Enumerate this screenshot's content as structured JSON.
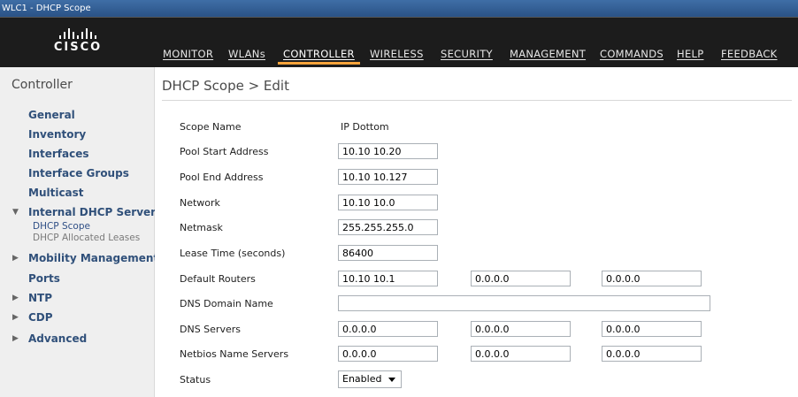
{
  "window": {
    "title": "WLC1 - DHCP Scope"
  },
  "brand": {
    "logo_text": "CISCO"
  },
  "nav": {
    "items": [
      {
        "label": "MONITOR"
      },
      {
        "label": "WLANs"
      },
      {
        "label": "CONTROLLER",
        "active": true
      },
      {
        "label": "WIRELESS"
      },
      {
        "label": "SECURITY"
      },
      {
        "label": "MANAGEMENT"
      },
      {
        "label": "COMMANDS"
      },
      {
        "label": "HELP"
      },
      {
        "label": "FEEDBACK"
      }
    ]
  },
  "sidebar": {
    "title": "Controller",
    "items": [
      {
        "label": "General"
      },
      {
        "label": "Inventory"
      },
      {
        "label": "Interfaces"
      },
      {
        "label": "Interface Groups"
      },
      {
        "label": "Multicast"
      },
      {
        "label": "Internal DHCP Server",
        "expanded": true
      },
      {
        "label": "Mobility Management"
      },
      {
        "label": "Ports"
      },
      {
        "label": "NTP"
      },
      {
        "label": "CDP"
      },
      {
        "label": "Advanced"
      }
    ],
    "sub_items": [
      {
        "label": "DHCP Scope",
        "active": true
      },
      {
        "label": "DHCP Allocated Leases"
      }
    ]
  },
  "main": {
    "title": "DHCP Scope > Edit",
    "fields": {
      "scope_name": {
        "label": "Scope Name",
        "value": "IP Dottom"
      },
      "pool_start": {
        "label": "Pool Start Address",
        "value": "10.10 10.20"
      },
      "pool_end": {
        "label": "Pool End Address",
        "value": "10.10 10.127"
      },
      "network": {
        "label": "Network",
        "value": "10.10 10.0"
      },
      "netmask": {
        "label": "Netmask",
        "value": "255.255.255.0"
      },
      "lease_time": {
        "label": "Lease Time (seconds)",
        "value": "86400"
      },
      "default_routers": {
        "label": "Default Routers",
        "values": [
          "10.10 10.1",
          "0.0.0.0",
          "0.0.0.0"
        ]
      },
      "dns_domain": {
        "label": "DNS Domain Name",
        "value": ""
      },
      "dns_servers": {
        "label": "DNS Servers",
        "values": [
          "0.0.0.0",
          "0.0.0.0",
          "0.0.0.0"
        ]
      },
      "netbios": {
        "label": "Netbios Name Servers",
        "values": [
          "0.0.0.0",
          "0.0.0.0",
          "0.0.0.0"
        ]
      },
      "status": {
        "label": "Status",
        "value": "Enabled"
      }
    }
  }
}
